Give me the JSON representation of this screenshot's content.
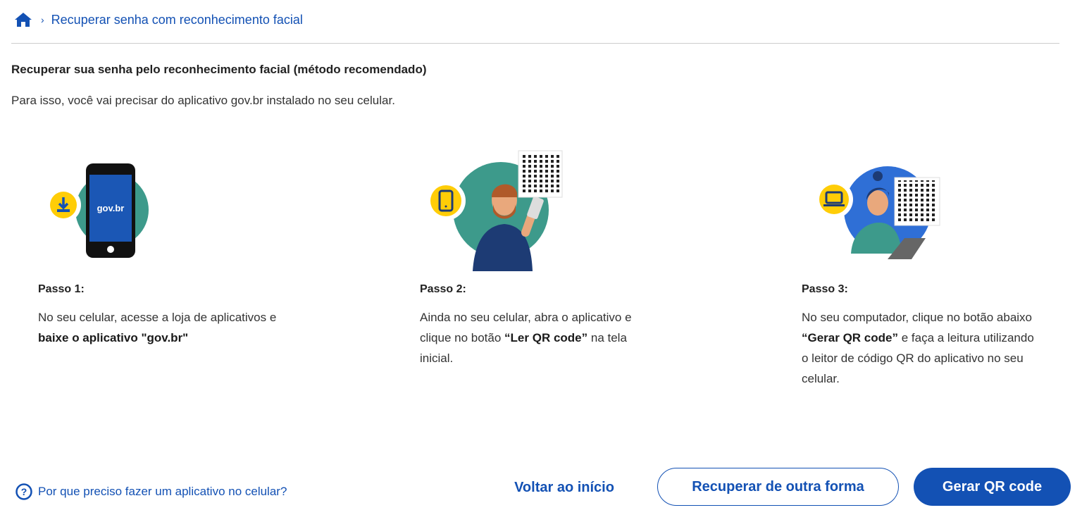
{
  "breadcrumb": {
    "home_icon": "home-icon",
    "separator": "›",
    "current": "Recuperar senha com reconhecimento facial"
  },
  "page": {
    "title": "Recuperar sua senha pelo reconhecimento facial (método recomendado)",
    "subtitle": "Para isso, você vai precisar do aplicativo gov.br instalado no seu celular."
  },
  "steps": [
    {
      "label": "Passo 1:",
      "text_before": "No seu celular, acesse a loja de aplicativos e ",
      "bold": "baixe o aplicativo \"gov.br\"",
      "text_after": "",
      "phone_brand": "gov.br",
      "icon": "download-icon"
    },
    {
      "label": "Passo 2:",
      "text_before": "Ainda no seu celular, abra o aplicativo e clique no botão ",
      "bold": "“Ler QR code”",
      "text_after": " na tela inicial.",
      "icon": "smartphone-icon"
    },
    {
      "label": "Passo 3:",
      "text_before": "No seu computador, clique no botão abaixo ",
      "bold": "“Gerar QR code”",
      "text_after": " e faça a leitura utilizando o leitor de código QR do aplicativo no seu celular.",
      "icon": "laptop-icon"
    }
  ],
  "footer": {
    "help_icon": "question-circle-icon",
    "help_text": "Por que preciso fazer um aplicativo no celular?",
    "back_label": "Voltar ao início",
    "other_label": "Recuperar de outra forma",
    "primary_label": "Gerar QR code"
  },
  "colors": {
    "primary": "#1351b4",
    "teal": "#3d9a8b",
    "yellow": "#ffcd07",
    "blue_circle": "#2f6fd6"
  }
}
